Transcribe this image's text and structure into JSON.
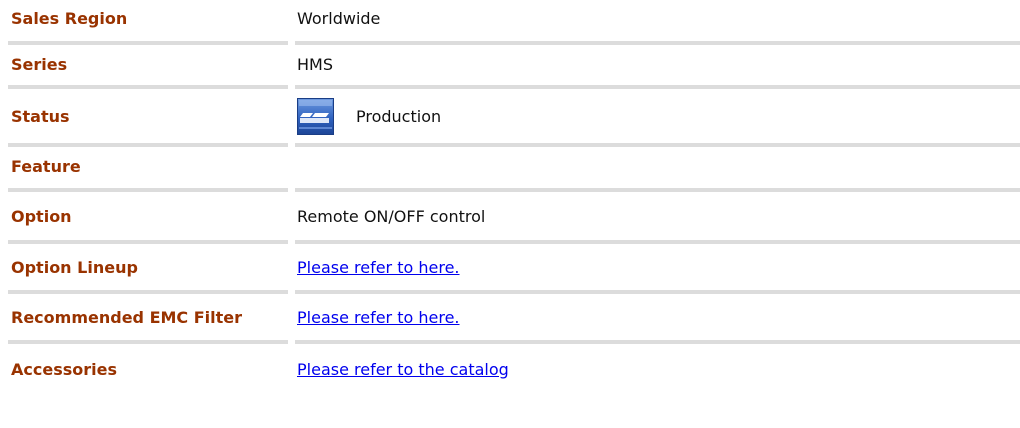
{
  "spec": {
    "sales_region": {
      "label": "Sales Region",
      "value": "Worldwide"
    },
    "series": {
      "label": "Series",
      "value": "HMS"
    },
    "status": {
      "label": "Status",
      "value": "Production",
      "icon": "production-status-icon"
    },
    "feature": {
      "label": "Feature",
      "value": ""
    },
    "option": {
      "label": "Option",
      "value": "Remote ON/OFF control"
    },
    "option_lineup": {
      "label": "Option Lineup",
      "link_text": "Please refer to here."
    },
    "emc_filter": {
      "label": "Recommended EMC Filter",
      "link_text": "Please refer to here."
    },
    "accessories": {
      "label": "Accessories",
      "link_text": "Please refer to the catalog"
    }
  },
  "colors": {
    "label": "#993300",
    "link": "#0000ee",
    "divider": "#dcdcdc",
    "icon_blue": "#3a6fc4"
  }
}
